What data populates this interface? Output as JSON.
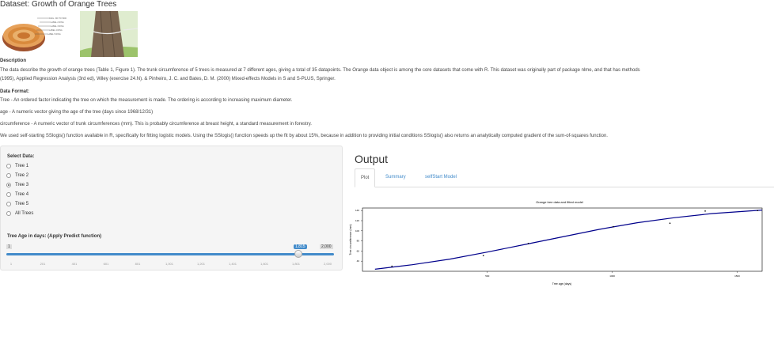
{
  "page": {
    "title": "Dataset: Growth of Orange Trees",
    "description_heading": "Description",
    "description_line1": "The data describe the growth of orange trees (Table 1, Figure 1). The trunk circumference of 5 trees is measured at 7 different ages, giving a total of 35 datapoints. The Orange data object is among the core datasets that come with R. This dataset was originally part of package nlme, and that has methods",
    "description_line2": "(1995), Applied Regression Analysis (3rd ed), Wiley (exercise 24.N). & Pinheiro, J. C. and Bates, D. M. (2000) Mixed-effects Models in S and S-PLUS, Springer.",
    "data_format_heading": "Data Format:",
    "format_tree": "Tree - An ordered factor indicating the tree on which the measurement is made. The ordering is according to increasing maximum diameter.",
    "format_age": "age - A numeric vector giving the age of the tree (days since 1968/12/31)",
    "format_circ": "circumference - A numeric vector of trunk circumferences (mm). This is probably circumference at breast height, a standard measurement in forestry.",
    "note": "We used self-starting SSlogis() function available in R, specifically for fitting logistic models. Using the SSlogis() function speeds up the fit by about 15%, because in addition to providing initial conditions SSlogis() also returns an analytically computed gradient of the sum-of-squares function."
  },
  "rings_labels": [
    "DIAG. 300 TO 5000",
    "LABEL 2 RING",
    "LABEL 3 RING",
    "LABEL 4 RING",
    "LABEL 5 RING"
  ],
  "controls": {
    "select_label": "Select Data:",
    "options": [
      "Tree 1",
      "Tree 2",
      "Tree 3",
      "Tree 4",
      "Tree 5",
      "All Trees"
    ],
    "selected": "Tree 3",
    "slider_label": "Tree Age in days: (Apply Predict function)",
    "slider_min": "1",
    "slider_max": "2,000",
    "slider_value": "1,815",
    "slider_ticks": [
      "1",
      "201",
      "401",
      "601",
      "801",
      "1,001",
      "1,201",
      "1,401",
      "1,601",
      "1,801",
      "2,000"
    ]
  },
  "output": {
    "heading": "Output",
    "tabs": [
      "Plot",
      "Summary",
      "selfStart Model"
    ],
    "active_tab": "Plot"
  },
  "colors": {
    "accent": "#428bca",
    "fit_line": "#00008b"
  },
  "chart_data": {
    "type": "line",
    "title": "Orange tree data and fitted model",
    "xlabel": "Tree age (days)",
    "ylabel": "Tree circumference (mm)",
    "xlim": [
      0,
      1600
    ],
    "ylim": [
      20,
      145
    ],
    "x_ticks": [
      "500",
      "1000",
      "1500"
    ],
    "y_ticks": [
      "40",
      "60",
      "80",
      "100",
      "120",
      "140"
    ],
    "points": [
      {
        "x": 118,
        "y": 30
      },
      {
        "x": 484,
        "y": 51
      },
      {
        "x": 664,
        "y": 75
      },
      {
        "x": 1004,
        "y": 108
      },
      {
        "x": 1231,
        "y": 115
      },
      {
        "x": 1372,
        "y": 139
      },
      {
        "x": 1582,
        "y": 140
      }
    ],
    "fit": [
      {
        "x": 50,
        "y": 24
      },
      {
        "x": 200,
        "y": 33
      },
      {
        "x": 350,
        "y": 44
      },
      {
        "x": 500,
        "y": 58
      },
      {
        "x": 650,
        "y": 73
      },
      {
        "x": 800,
        "y": 88
      },
      {
        "x": 950,
        "y": 103
      },
      {
        "x": 1100,
        "y": 116
      },
      {
        "x": 1250,
        "y": 126
      },
      {
        "x": 1400,
        "y": 134
      },
      {
        "x": 1600,
        "y": 141
      }
    ]
  }
}
